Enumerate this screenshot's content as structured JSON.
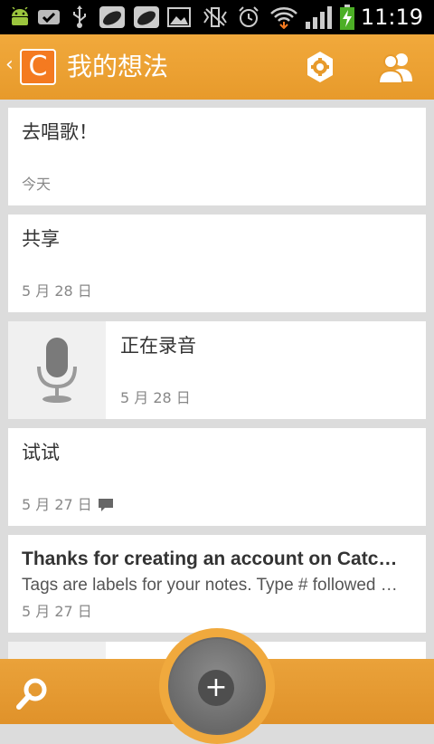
{
  "status_bar": {
    "time": "11:19",
    "icons": [
      "android-debug-icon",
      "check-icon",
      "usb-icon",
      "pea-pod-icon",
      "pea-pod-icon",
      "image-icon",
      "vibrate-icon",
      "alarm-icon",
      "wifi-icon",
      "signal-icon",
      "battery-charging-icon"
    ]
  },
  "action_bar": {
    "back_glyph": "‹",
    "logo_letter": "C",
    "title": "我的想法",
    "settings_icon": "gear-icon",
    "people_icon": "people-icon"
  },
  "notes": [
    {
      "title": "去唱歌！",
      "date": "今天"
    },
    {
      "title": "共享",
      "date": "5 月 28 日"
    },
    {
      "title": "正在录音",
      "date": "5 月 28 日",
      "thumb": "microphone-icon"
    },
    {
      "title": "试试",
      "date": "5 月 27 日",
      "badge": "comment-icon"
    },
    {
      "title": "Thanks for creating an account on Catc…",
      "body": "Tags are labels for your notes. Type # followed …",
      "date": "5 月 27 日"
    }
  ],
  "bottom_bar": {
    "search_icon": "search-icon",
    "add_label": "+"
  },
  "colors": {
    "accent": "#e79a2b",
    "logo": "#f47a20",
    "fab": "#5c5c5c"
  }
}
